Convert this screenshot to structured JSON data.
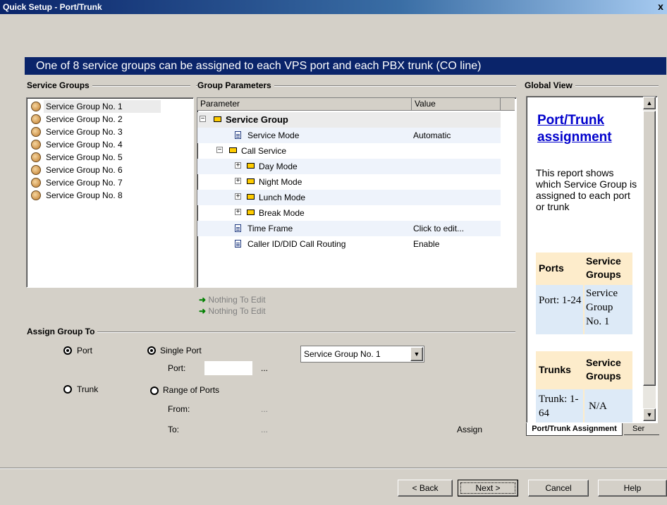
{
  "window": {
    "title": "Quick Setup - Port/Trunk",
    "close_glyph": "x"
  },
  "banner": "One of 8 service groups can be assigned to each VPS port and each PBX trunk (CO line)",
  "service_groups": {
    "title": "Service Groups",
    "items": [
      "Service Group No. 1",
      "Service Group No. 2",
      "Service Group No. 3",
      "Service Group No. 4",
      "Service Group No. 5",
      "Service Group No. 6",
      "Service Group No. 7",
      "Service Group No. 8"
    ]
  },
  "group_parameters": {
    "title": "Group Parameters",
    "col_parameter": "Parameter",
    "col_value": "Value",
    "rows": [
      {
        "name": "Service Group",
        "value": "",
        "expander": "−"
      },
      {
        "name": "Service Mode",
        "value": "Automatic"
      },
      {
        "name": "Call Service",
        "value": "",
        "expander": "−"
      },
      {
        "name": "Day Mode",
        "value": "",
        "expander": "+"
      },
      {
        "name": "Night Mode",
        "value": "",
        "expander": "+"
      },
      {
        "name": "Lunch Mode",
        "value": "",
        "expander": "+"
      },
      {
        "name": "Break Mode",
        "value": "",
        "expander": "+"
      },
      {
        "name": "Time Frame",
        "value": "Click to edit..."
      },
      {
        "name": "Caller ID/DID Call Routing",
        "value": "Enable"
      }
    ],
    "nothing_to_edit_1": "Nothing To Edit",
    "nothing_to_edit_2": "Nothing To Edit"
  },
  "global_view": {
    "title": "Global View",
    "heading": "Port/Trunk assignment",
    "description": "This report shows which Service Group is assigned to each port or trunk",
    "ports_header": "Ports",
    "sg_header": "Service Groups",
    "port_value": "Port: 1-24",
    "port_group": "Service Group No. 1",
    "trunks_header": "Trunks",
    "trunk_value": "Trunk: 1-64",
    "trunk_group": "N/A",
    "tab_active": "Port/Trunk Assignment",
    "tab_other": "Ser"
  },
  "assign": {
    "title": "Assign Group To",
    "port_radio": "Port",
    "trunk_radio": "Trunk",
    "single_port": "Single Port",
    "port_label": "Port:",
    "range_of_ports": "Range of Ports",
    "from_label": "From:",
    "to_label": "To:",
    "ellipsis": "...",
    "group_select": "Service Group No. 1",
    "assign_button": "Assign"
  },
  "buttons": {
    "back": "< Back",
    "next": "Next >",
    "cancel": "Cancel",
    "help": "Help"
  }
}
